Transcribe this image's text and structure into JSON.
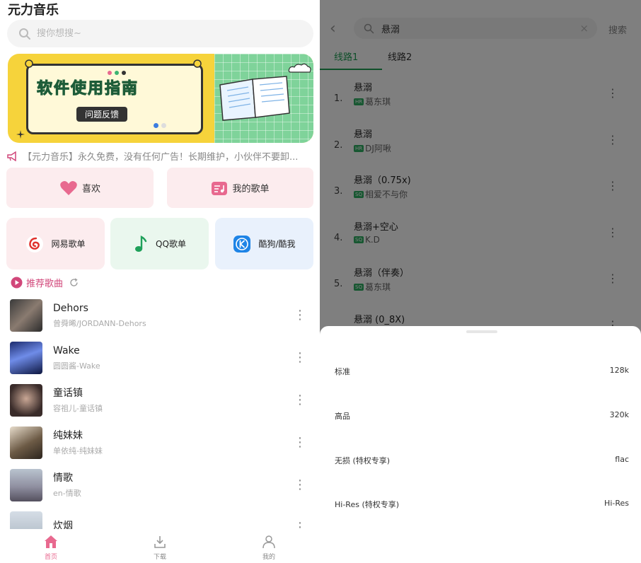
{
  "left": {
    "app_title": "元力音乐",
    "search": {
      "placeholder": "搜你想搜~"
    },
    "banner": {
      "title": "软件使用指南",
      "subtitle": "问题反馈"
    },
    "notice": "【元力音乐】永久免费，没有任何广告！长期维护，小伙伴不要卸...",
    "quick_actions": [
      {
        "label": "喜欢",
        "icon": "heart-icon"
      },
      {
        "label": "我的歌单",
        "icon": "playlist-icon"
      }
    ],
    "sources": [
      {
        "label": "网易歌单",
        "icon": "netease-icon",
        "bg": "#fcecee"
      },
      {
        "label": "QQ歌单",
        "icon": "qq-music-icon",
        "bg": "#eaf7ee"
      },
      {
        "label": "酷狗/酷我",
        "icon": "kugou-icon",
        "bg": "#e9f1fc"
      }
    ],
    "recommend_label": "推荐歌曲",
    "songs": [
      {
        "title": "Dehors",
        "sub": "曾舜晞/JORDANN-Dehors"
      },
      {
        "title": "Wake",
        "sub": "圆圆酱-Wake"
      },
      {
        "title": "童话镇",
        "sub": "容祖儿-童话镇"
      },
      {
        "title": "纯妹妹",
        "sub": "单依纯-纯妹妹"
      },
      {
        "title": "情歌",
        "sub": "en-情歌"
      },
      {
        "title": "炊烟",
        "sub": ""
      }
    ],
    "nav": [
      {
        "label": "首页"
      },
      {
        "label": "下载"
      },
      {
        "label": "我的"
      }
    ],
    "colors": {
      "accent": "#e8698f",
      "title_green": "#3cb371"
    }
  },
  "right": {
    "search_query": "悬溺",
    "search_button": "搜索",
    "tabs": [
      {
        "label": "线路1"
      },
      {
        "label": "线路2"
      }
    ],
    "results": [
      {
        "num": "1.",
        "title": "悬溺",
        "badge": "HR",
        "artist": "葛东琪"
      },
      {
        "num": "2.",
        "title": "悬溺",
        "badge": "HR",
        "artist": "DJ阿啾"
      },
      {
        "num": "3.",
        "title": "悬溺（0.75x)",
        "badge": "SQ",
        "artist": "相爱不与你"
      },
      {
        "num": "4.",
        "title": "悬溺+空心",
        "badge": "SQ",
        "artist": "K.D"
      },
      {
        "num": "5.",
        "title": "悬溺（伴奏）",
        "badge": "SQ",
        "artist": "葛东琪"
      },
      {
        "num": "6.",
        "title": "悬溺 (0_8X)",
        "badge": "",
        "artist": ""
      }
    ],
    "quality_options": [
      {
        "name": "标准",
        "value": "128k"
      },
      {
        "name": "高品",
        "value": "320k"
      },
      {
        "name": "无损 (特权专享)",
        "value": "flac"
      },
      {
        "name": "Hi-Res (特权专享)",
        "value": "Hi-Res"
      }
    ],
    "colors": {
      "accent": "#1f9f55"
    }
  }
}
